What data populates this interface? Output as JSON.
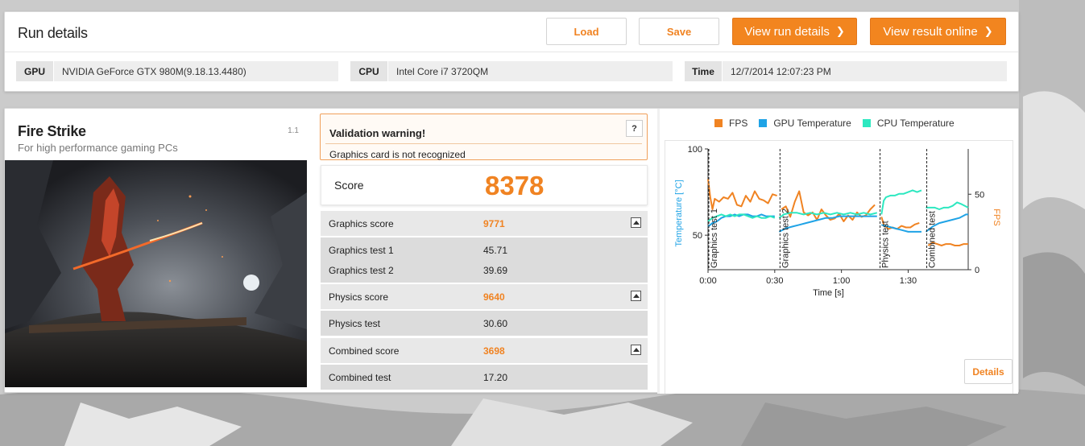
{
  "run_details": {
    "title": "Run details",
    "buttons": {
      "load": "Load",
      "save": "Save",
      "view_run_details": "View run details",
      "view_result_online": "View result online"
    },
    "gpu": {
      "key": "GPU",
      "value": "NVIDIA GeForce GTX 980M(9.18.13.4480)"
    },
    "cpu": {
      "key": "CPU",
      "value": "Intel Core i7 3720QM"
    },
    "time": {
      "key": "Time",
      "value": "12/7/2014 12:07:23 PM"
    }
  },
  "test": {
    "name": "Fire Strike",
    "version": "1.1",
    "subtitle": "For high performance gaming PCs"
  },
  "validation": {
    "title": "Validation warning!",
    "help": "?",
    "message": "Graphics card is not recognized"
  },
  "score": {
    "label": "Score",
    "value": "8378"
  },
  "results": {
    "graphics_score": {
      "label": "Graphics score",
      "value": "9771"
    },
    "graphics_test_1": {
      "label": "Graphics test 1",
      "value": "45.71"
    },
    "graphics_test_2": {
      "label": "Graphics test 2",
      "value": "39.69"
    },
    "physics_score": {
      "label": "Physics score",
      "value": "9640"
    },
    "physics_test": {
      "label": "Physics test",
      "value": "30.60"
    },
    "combined_score": {
      "label": "Combined score",
      "value": "3698"
    },
    "combined_test": {
      "label": "Combined test",
      "value": "17.20"
    }
  },
  "details_button": "Details",
  "colors": {
    "accent": "#f08322",
    "fps": "#f08322",
    "gpu_temp": "#1fa3e6",
    "cpu_temp": "#2de8c0"
  },
  "chart_data": {
    "type": "line",
    "xlabel": "Time [s]",
    "ylabel_left": "Temperature [°C]",
    "ylabel_right": "FPS",
    "x_ticks": [
      "0:00",
      "0:30",
      "1:00",
      "1:30"
    ],
    "x_tick_values": [
      0,
      30,
      60,
      90
    ],
    "xlim": [
      0,
      117
    ],
    "y_left_ticks": [
      "100",
      "50"
    ],
    "y_left_tick_values": [
      100,
      50
    ],
    "y_left_lim": [
      30,
      100
    ],
    "y_right_ticks": [
      "50",
      "0"
    ],
    "y_right_tick_values": [
      50,
      0
    ],
    "y_right_lim": [
      0,
      80
    ],
    "sections": [
      {
        "label": "Graphics test 1",
        "start": 0
      },
      {
        "label": "Graphics test 2",
        "start": 32
      },
      {
        "label": "Physics test",
        "start": 77
      },
      {
        "label": "Combined test",
        "start": 98
      }
    ],
    "legend": [
      "FPS",
      "GPU Temperature",
      "CPU Temperature"
    ],
    "series": [
      {
        "name": "FPS",
        "axis": "right",
        "segments": [
          {
            "x": [
              0,
              1,
              2,
              3,
              5,
              7,
              9,
              11,
              13,
              15,
              17,
              19,
              21,
              23,
              25,
              27,
              29,
              31
            ],
            "y": [
              60,
              48,
              40,
              47,
              45,
              48,
              47,
              51,
              43,
              42,
              49,
              45,
              52,
              47,
              46,
              44,
              50,
              49
            ]
          },
          {
            "x": [
              33,
              35,
              37,
              39,
              41,
              43,
              45,
              47,
              49,
              51,
              53,
              55,
              57,
              59,
              61,
              63,
              65,
              67,
              69,
              71,
              73,
              75
            ],
            "y": [
              40,
              42,
              35,
              45,
              52,
              38,
              36,
              38,
              33,
              40,
              36,
              33,
              34,
              37,
              32,
              36,
              33,
              38,
              35,
              36,
              40,
              43
            ]
          },
          {
            "x": [
              78,
              79,
              81,
              83,
              85,
              87,
              89,
              91,
              93,
              95
            ],
            "y": [
              35,
              30,
              27,
              28,
              27,
              29,
              28,
              28,
              30,
              31
            ]
          },
          {
            "x": [
              99,
              101,
              103,
              105,
              107,
              109,
              111,
              113,
              115,
              117
            ],
            "y": [
              16,
              18,
              17,
              16,
              17,
              17,
              16,
              16,
              17,
              17
            ]
          }
        ]
      },
      {
        "name": "GPU Temperature",
        "axis": "left",
        "segments": [
          {
            "x": [
              0,
              2,
              4,
              6,
              8,
              10,
              12,
              14,
              16,
              18,
              20,
              22,
              24,
              26,
              28,
              30
            ],
            "y": [
              55,
              57,
              58,
              60,
              61,
              61,
              62,
              61,
              62,
              62,
              61,
              61,
              62,
              61,
              61,
              61
            ]
          },
          {
            "x": [
              32,
              35,
              38,
              41,
              44,
              47,
              50,
              53,
              56,
              59,
              62,
              65,
              68,
              71,
              74,
              76
            ],
            "y": [
              52,
              54,
              55,
              56,
              57,
              58,
              59,
              60,
              60,
              61,
              61,
              61,
              61,
              61,
              61,
              61
            ]
          },
          {
            "x": [
              78,
              81,
              84,
              87,
              90,
              93,
              96
            ],
            "y": [
              56,
              55,
              54,
              53,
              52,
              52,
              52
            ]
          },
          {
            "x": [
              98,
              101,
              104,
              107,
              110,
              113,
              116,
              117
            ],
            "y": [
              52,
              55,
              57,
              58,
              59,
              60,
              62,
              62
            ]
          }
        ]
      },
      {
        "name": "CPU Temperature",
        "axis": "left",
        "segments": [
          {
            "x": [
              0,
              2,
              4,
              6,
              8,
              10,
              12,
              14,
              16,
              18,
              20,
              22,
              24,
              26,
              28,
              30
            ],
            "y": [
              58,
              60,
              61,
              62,
              61,
              62,
              61,
              62,
              62,
              61,
              60,
              61,
              60,
              60,
              61,
              60
            ]
          },
          {
            "x": [
              32,
              34,
              37,
              40,
              43,
              46,
              49,
              52,
              55,
              58,
              61,
              64,
              67,
              70,
              73,
              76
            ],
            "y": [
              60,
              62,
              63,
              63,
              62,
              63,
              62,
              63,
              62,
              63,
              62,
              63,
              62,
              63,
              62,
              63
            ]
          },
          {
            "x": [
              78,
              79,
              80,
              82,
              84,
              86,
              88,
              90,
              92,
              94,
              96
            ],
            "y": [
              62,
              70,
              72,
              73,
              73,
              74,
              74,
              75,
              76,
              75,
              76
            ]
          },
          {
            "x": [
              98,
              100,
              102,
              104,
              106,
              108,
              110,
              112,
              114,
              117
            ],
            "y": [
              66,
              66,
              66,
              65,
              66,
              66,
              67,
              69,
              68,
              66
            ]
          }
        ]
      }
    ]
  }
}
